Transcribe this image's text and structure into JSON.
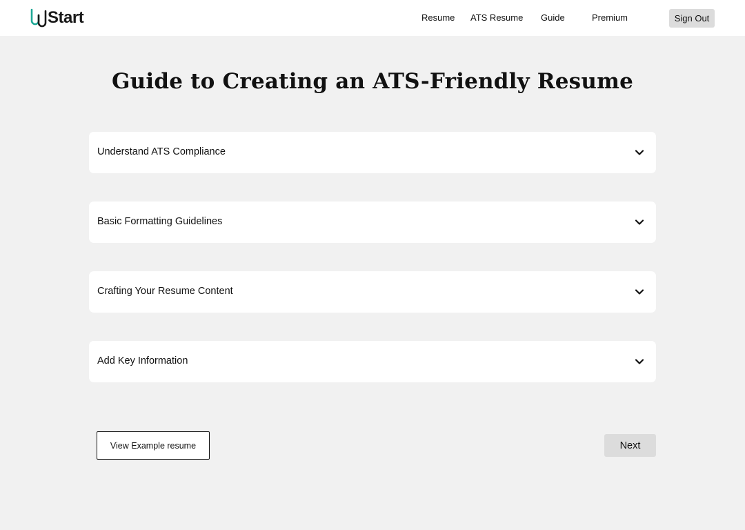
{
  "header": {
    "logo_text": "Start",
    "nav": [
      "Resume",
      "ATS Resume",
      "Guide",
      "Premium"
    ],
    "sign_out_label": "Sign Out",
    "brand_color": "#1ea896"
  },
  "main": {
    "title": "Guide to Creating an ATS-Friendly Resume",
    "sections": [
      {
        "label": "Understand ATS Compliance",
        "icon": "chevron-down-icon"
      },
      {
        "label": "Basic Formatting Guidelines",
        "icon": "chevron-down-icon"
      },
      {
        "label": "Crafting Your Resume Content",
        "icon": "chevron-down-icon"
      },
      {
        "label": "Add Key Information",
        "icon": "chevron-down-icon"
      }
    ],
    "example_button_label": "View Example resume",
    "next_button_label": "Next"
  }
}
